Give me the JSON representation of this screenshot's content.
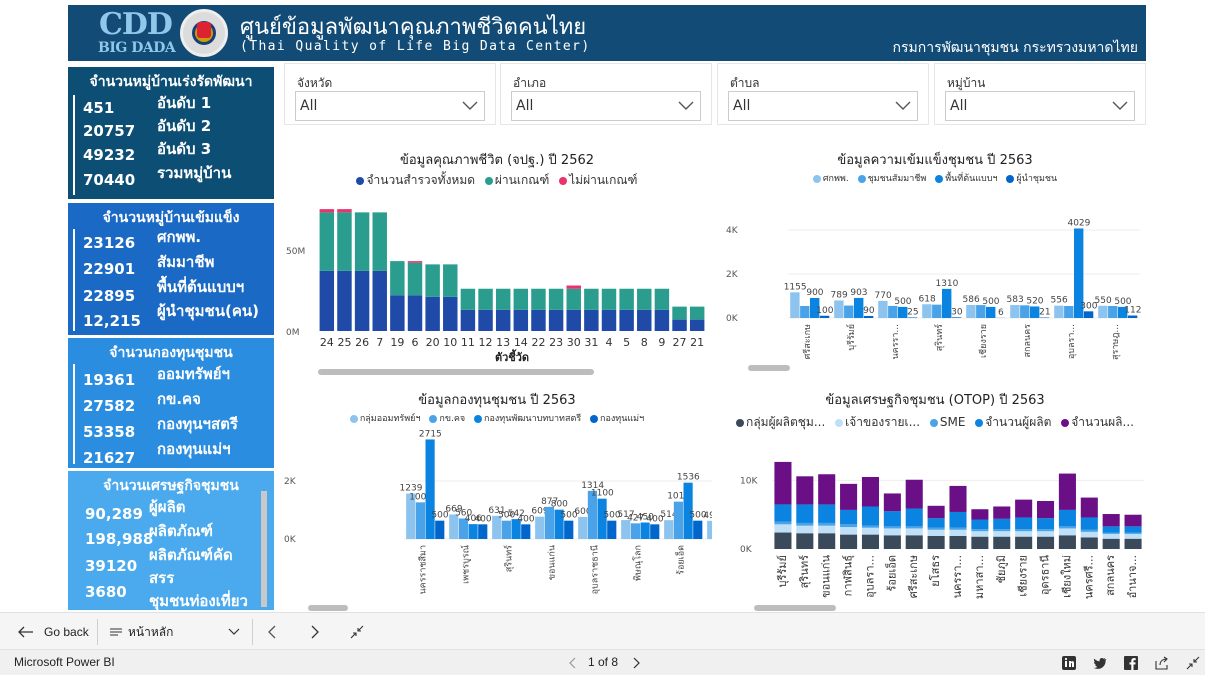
{
  "header": {
    "logo_cdd": "CDD",
    "logo_big": "BIG DADA",
    "title": "ศูนย์ข้อมูลพัฒนาคุณภาพชีวิตคนไทย",
    "subtitle": "(Thai Quality of Life Big Data Center)",
    "org": "กรมการพัฒนาชุมชน กระทรวงมหาดไทย"
  },
  "kpi1": {
    "title": "จำนวนหมู่บ้านเร่งรัดพัฒนา",
    "rows": [
      {
        "v": "451",
        "l": "อันดับ 1"
      },
      {
        "v": "20757",
        "l": "อันดับ 2"
      },
      {
        "v": "49232",
        "l": "อันดับ 3"
      },
      {
        "v": "70440",
        "l": "รวมหมู่บ้าน"
      }
    ]
  },
  "kpi2": {
    "title": "จำนวนหมู่บ้านเข้มแข็ง",
    "rows": [
      {
        "v": "23126",
        "l": "ศกพพ."
      },
      {
        "v": "22901",
        "l": "สัมมาชีพ"
      },
      {
        "v": "22895",
        "l": "พื้นที่ต้นแบบฯ"
      },
      {
        "v": "12,215",
        "l": "ผู้นำชุมชน(คน)"
      }
    ]
  },
  "kpi3": {
    "title": "จำนวนกองทุนชุมชน",
    "rows": [
      {
        "v": "19361",
        "l": "ออมทรัพย์ฯ"
      },
      {
        "v": "27582",
        "l": "กข.คจ"
      },
      {
        "v": "53358",
        "l": "กองทุนฯสตรี"
      },
      {
        "v": "21627",
        "l": "กองทุนแม่ฯ"
      }
    ]
  },
  "kpi4": {
    "title": "จำนวนเศรษฐกิจชุมชน",
    "rows": [
      {
        "v": "90,289",
        "l": "ผู้ผลิต"
      },
      {
        "v": "198,988",
        "l": "ผลิตภัณฑ์"
      },
      {
        "v": "39120",
        "l": "ผลิตภัณฑ์คัด"
      },
      {
        "v": "3680",
        "l": "สรร"
      },
      {
        "v": "",
        "l": "ชุมชนท่องเที่ยว"
      }
    ]
  },
  "filters": [
    {
      "label": "จังหวัด",
      "value": "All"
    },
    {
      "label": "อำเภอ",
      "value": "All"
    },
    {
      "label": "ตำบล",
      "value": "All"
    },
    {
      "label": "หมู่บ้าน",
      "value": "All"
    }
  ],
  "colors": {
    "navy": "#114b76",
    "blue_dark": "#1f4aa8",
    "teal": "#2a9d8f",
    "pink": "#e8336b",
    "sky": "#8cc4ef",
    "blue_mid": "#4aa3e8",
    "blue": "#0a84e0",
    "purple": "#6b0f86",
    "slate": "#3a4a5a",
    "light": "#bfe0f7"
  },
  "chart_data": [
    {
      "type": "bar",
      "title": "ข้อมูลคุณภาพชีวิต (จปฐ.) ปี 2562",
      "xlabel": "ตัวชี้วัด",
      "ylabel": "",
      "yticks": [
        "0M",
        "50M"
      ],
      "ylim": [
        0,
        80
      ],
      "categories": [
        "24",
        "25",
        "26",
        "7",
        "19",
        "6",
        "20",
        "10",
        "11",
        "12",
        "13",
        "14",
        "22",
        "23",
        "30",
        "31",
        "4",
        "5",
        "8",
        "9",
        "27",
        "21"
      ],
      "series": [
        {
          "name": "จำนวนสำรวจทั้งหมด",
          "values": [
            37,
            37,
            37,
            37,
            22,
            22,
            21,
            21,
            13,
            13,
            13,
            13,
            13,
            13,
            13,
            13,
            13,
            13,
            13,
            13,
            7,
            7
          ]
        },
        {
          "name": "ผ่านเกณฑ์",
          "values": [
            36,
            36,
            36,
            36,
            21,
            20,
            20,
            20,
            13,
            13,
            13,
            13,
            13,
            13,
            13,
            13,
            13,
            13,
            13,
            13,
            8,
            8
          ]
        },
        {
          "name": "ไม่ผ่านเกณฑ์",
          "values": [
            2,
            2,
            0,
            0,
            0,
            1,
            0,
            0,
            0,
            0,
            0,
            0,
            0,
            0,
            2,
            0,
            0,
            0,
            0,
            0,
            0,
            0
          ]
        }
      ]
    },
    {
      "type": "bar",
      "title": "ข้อมูลความเข้มแข็งชุมชน ปี 2563",
      "yticks": [
        "0K",
        "2K",
        "4K"
      ],
      "ylim": [
        0,
        4500
      ],
      "categories": [
        "ศรีสะเกษ",
        "บุรีรัมย์",
        "นครรา...",
        "สุรินทร์",
        "เชียงราย",
        "สกลนคร",
        "อุบลรา...",
        "สุราษฎ..."
      ],
      "series": [
        {
          "name": "ศกพพ.",
          "values": [
            1155,
            789,
            770,
            618,
            586,
            583,
            556,
            550
          ]
        },
        {
          "name": "ชุมชนสัมมาชีพ",
          "values": [
            541,
            560,
            544,
            600,
            580,
            570,
            540,
            540
          ]
        },
        {
          "name": "พื้นที่ต้นแบบฯ",
          "values": [
            900,
            903,
            500,
            1310,
            500,
            520,
            4029,
            500
          ]
        },
        {
          "name": "ผู้นำชุมชน",
          "values": [
            100,
            90,
            25,
            30,
            6,
            21,
            300,
            112
          ]
        }
      ]
    },
    {
      "type": "bar",
      "title": "ข้อมูลกองทุนชุมชน ปี 2563",
      "yticks": [
        "0K",
        "2K"
      ],
      "ylim": [
        0,
        3000
      ],
      "categories": [
        "นครราชสีมา",
        "เพชรบูรณ์",
        "สุรินทร์",
        "ขอนแก่น",
        "อุบลราชธานี",
        "พิษณุโลก",
        "ร้อยเอ็ด",
        "สกลนคร"
      ],
      "series": [
        {
          "name": "กลุ่มออมทรัพย์ฯ",
          "values": [
            1239,
            669,
            631,
            609,
            600,
            517,
            514,
            496
          ]
        },
        {
          "name": "กข.คจ",
          "values": [
            1000,
            560,
            500,
            877,
            1314,
            427,
            1019,
            600
          ]
        },
        {
          "name": "กองทุนพัฒนาบทบาทสตรี",
          "values": [
            2715,
            406,
            542,
            800,
            1100,
            450,
            1536,
            1048
          ]
        },
        {
          "name": "กองทุนแม่ฯ",
          "values": [
            500,
            400,
            400,
            500,
            500,
            400,
            500,
            367
          ]
        }
      ]
    },
    {
      "type": "bar",
      "stacked": true,
      "title": "ข้อมูลเศรษฐกิจชุมชน (OTOP) ปี 2563",
      "yticks": [
        "0K",
        "10K"
      ],
      "ylim": [
        0,
        14000
      ],
      "categories": [
        "บุรีรัมย์",
        "สุรินทร์",
        "ขอนแก่น",
        "กาฬสินธุ์",
        "อุบลรา...",
        "ร้อยเอ็ด",
        "ศรีสะเกษ",
        "ยโสธร",
        "นครรา...",
        "มหาสา...",
        "ชัยภูมิ",
        "เชียงราย",
        "อุดรธานี",
        "เชียงใหม่",
        "นครศรี...",
        "สกลนคร",
        "อำนาจ..."
      ],
      "series": [
        {
          "name": "กลุ่มผู้ผลิตชุม...",
          "values": [
            2400,
            2300,
            2300,
            2100,
            2100,
            2000,
            2000,
            1900,
            1900,
            1800,
            1800,
            1800,
            1800,
            2000,
            1700,
            1500,
            1500
          ]
        },
        {
          "name": "เจ้าของรายเ...",
          "values": [
            1200,
            1100,
            1100,
            1100,
            1000,
            1000,
            1000,
            900,
            900,
            800,
            800,
            800,
            800,
            1000,
            800,
            700,
            700
          ]
        },
        {
          "name": "SME",
          "values": [
            400,
            400,
            400,
            400,
            300,
            300,
            300,
            300,
            300,
            300,
            300,
            300,
            300,
            300,
            300,
            200,
            200
          ]
        },
        {
          "name": "จำนวนผู้ผลิต",
          "values": [
            2500,
            2700,
            2700,
            2100,
            2800,
            2200,
            2600,
            1400,
            2300,
            1400,
            1500,
            1700,
            1600,
            2400,
            1800,
            900,
            900
          ]
        },
        {
          "name": "จำนวนผลิ...",
          "values": [
            6200,
            4100,
            4400,
            3800,
            4300,
            2600,
            4200,
            1800,
            3800,
            1500,
            1800,
            2600,
            2500,
            5300,
            2900,
            1800,
            1700
          ]
        }
      ]
    }
  ],
  "toolbar": {
    "back": "Go back",
    "page_menu": "หน้าหลัก"
  },
  "status": {
    "app": "Microsoft Power BI",
    "page": "1 of 8"
  }
}
